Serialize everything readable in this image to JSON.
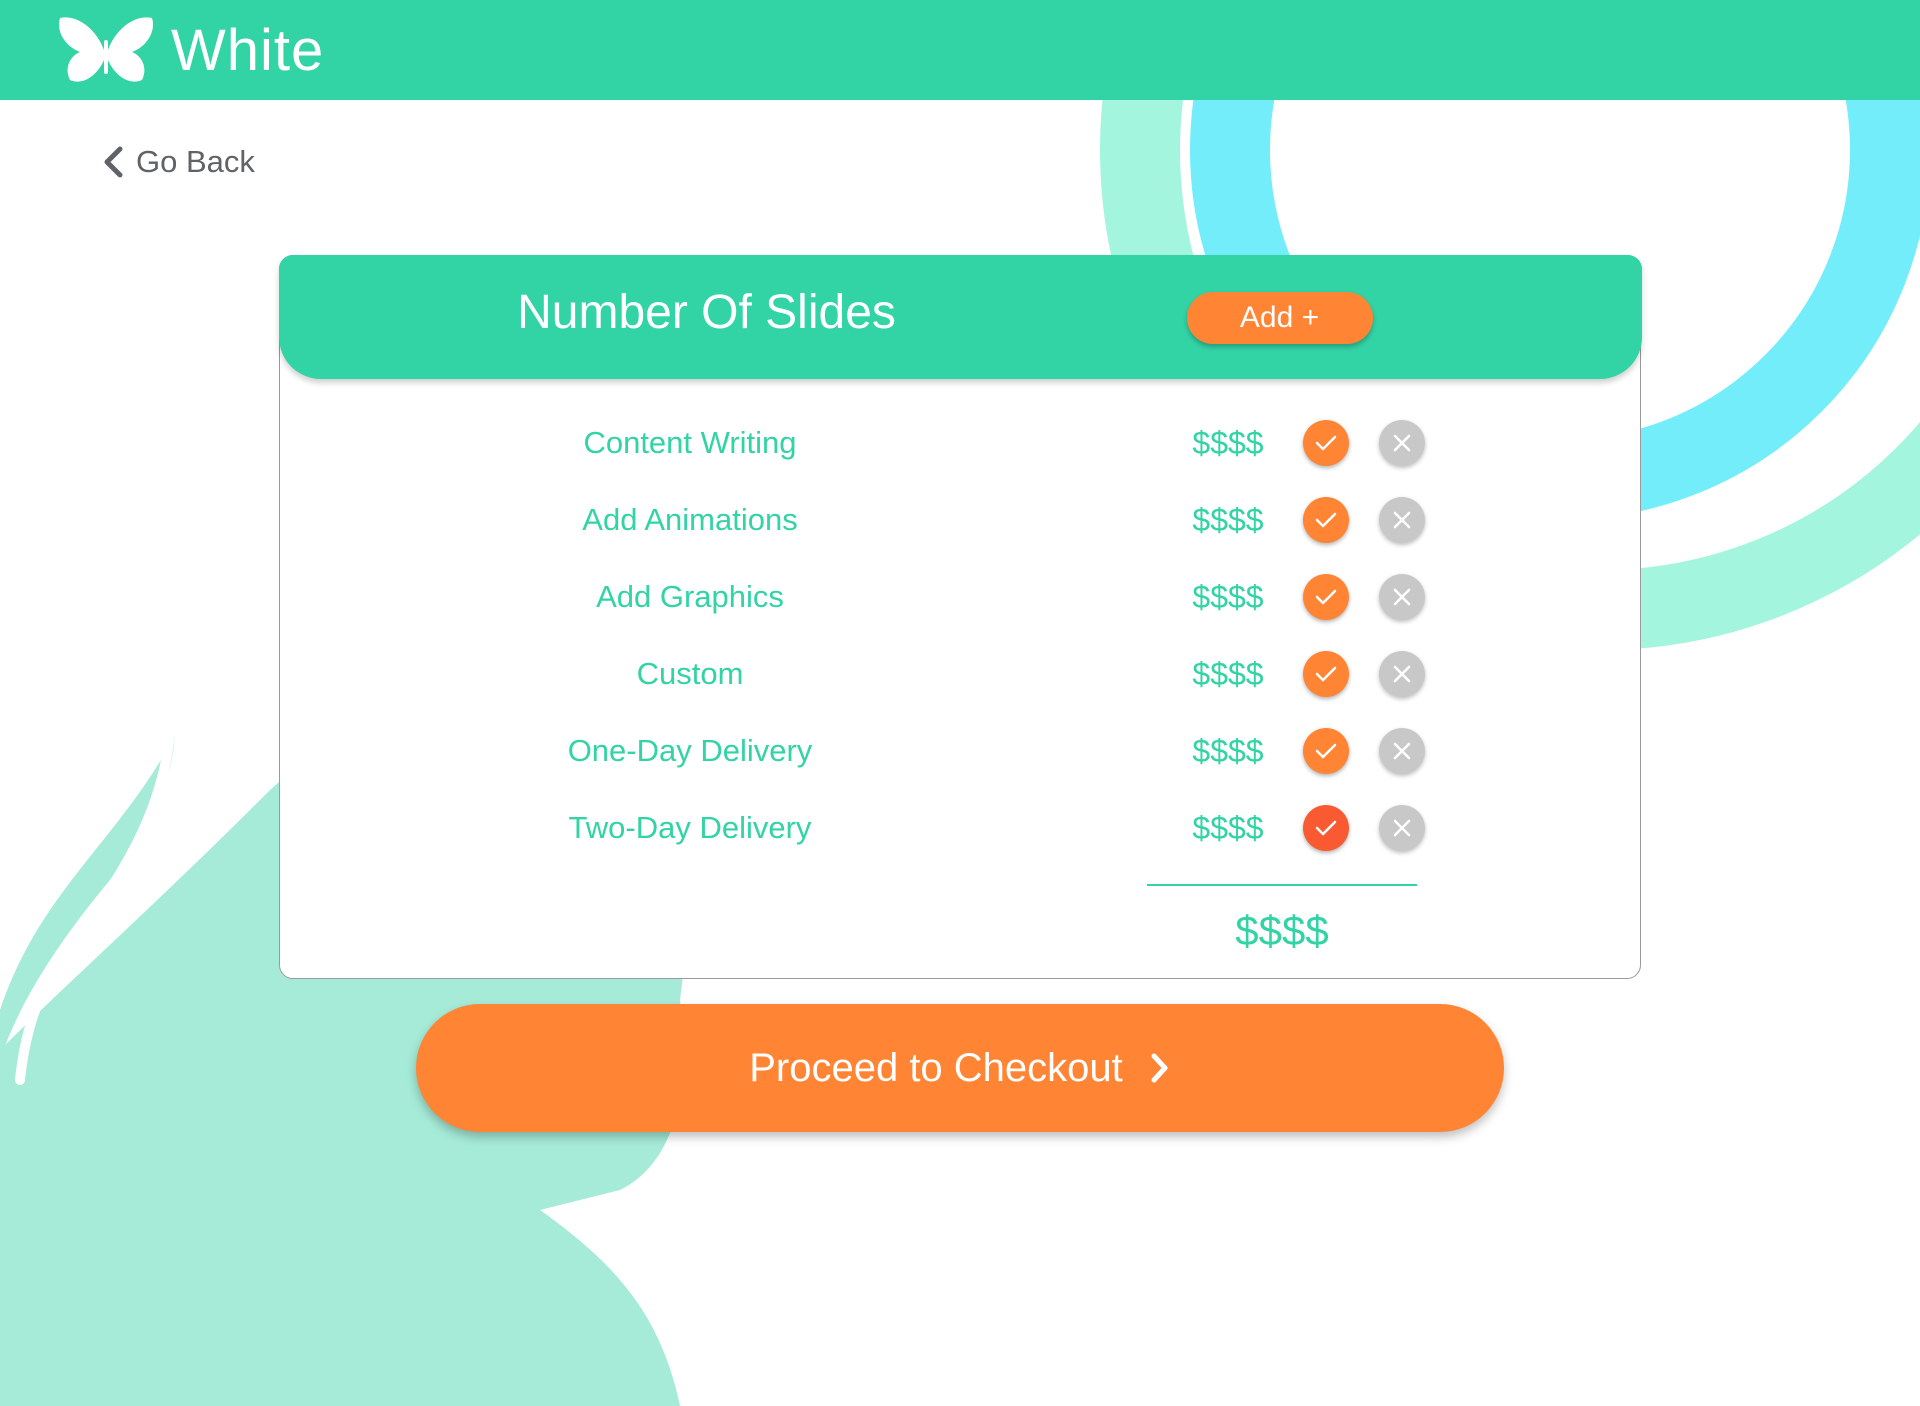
{
  "app": {
    "brand": "White",
    "colors": {
      "primary": "#32D3A5",
      "accent": "#FF8433",
      "accent_active": "#FA5A32",
      "muted": "#C8C8C8",
      "cyan": "#73EDFA",
      "mint": "#A3F5DD"
    }
  },
  "nav": {
    "back_label": "Go Back",
    "back_icon": "chevron-left-icon"
  },
  "card": {
    "title": "Number Of Slides",
    "add_label": "Add +",
    "rows": [
      {
        "label": "Content Writing",
        "price": "$$$$",
        "selected": false
      },
      {
        "label": "Add Animations",
        "price": "$$$$",
        "selected": false
      },
      {
        "label": "Add Graphics",
        "price": "$$$$",
        "selected": false
      },
      {
        "label": "Custom",
        "price": "$$$$",
        "selected": false
      },
      {
        "label": "One-Day Delivery",
        "price": "$$$$",
        "selected": false
      },
      {
        "label": "Two-Day Delivery",
        "price": "$$$$",
        "selected": true
      }
    ],
    "total": "$$$$"
  },
  "checkout": {
    "label": "Proceed to Checkout",
    "icon": "chevron-right-icon"
  }
}
